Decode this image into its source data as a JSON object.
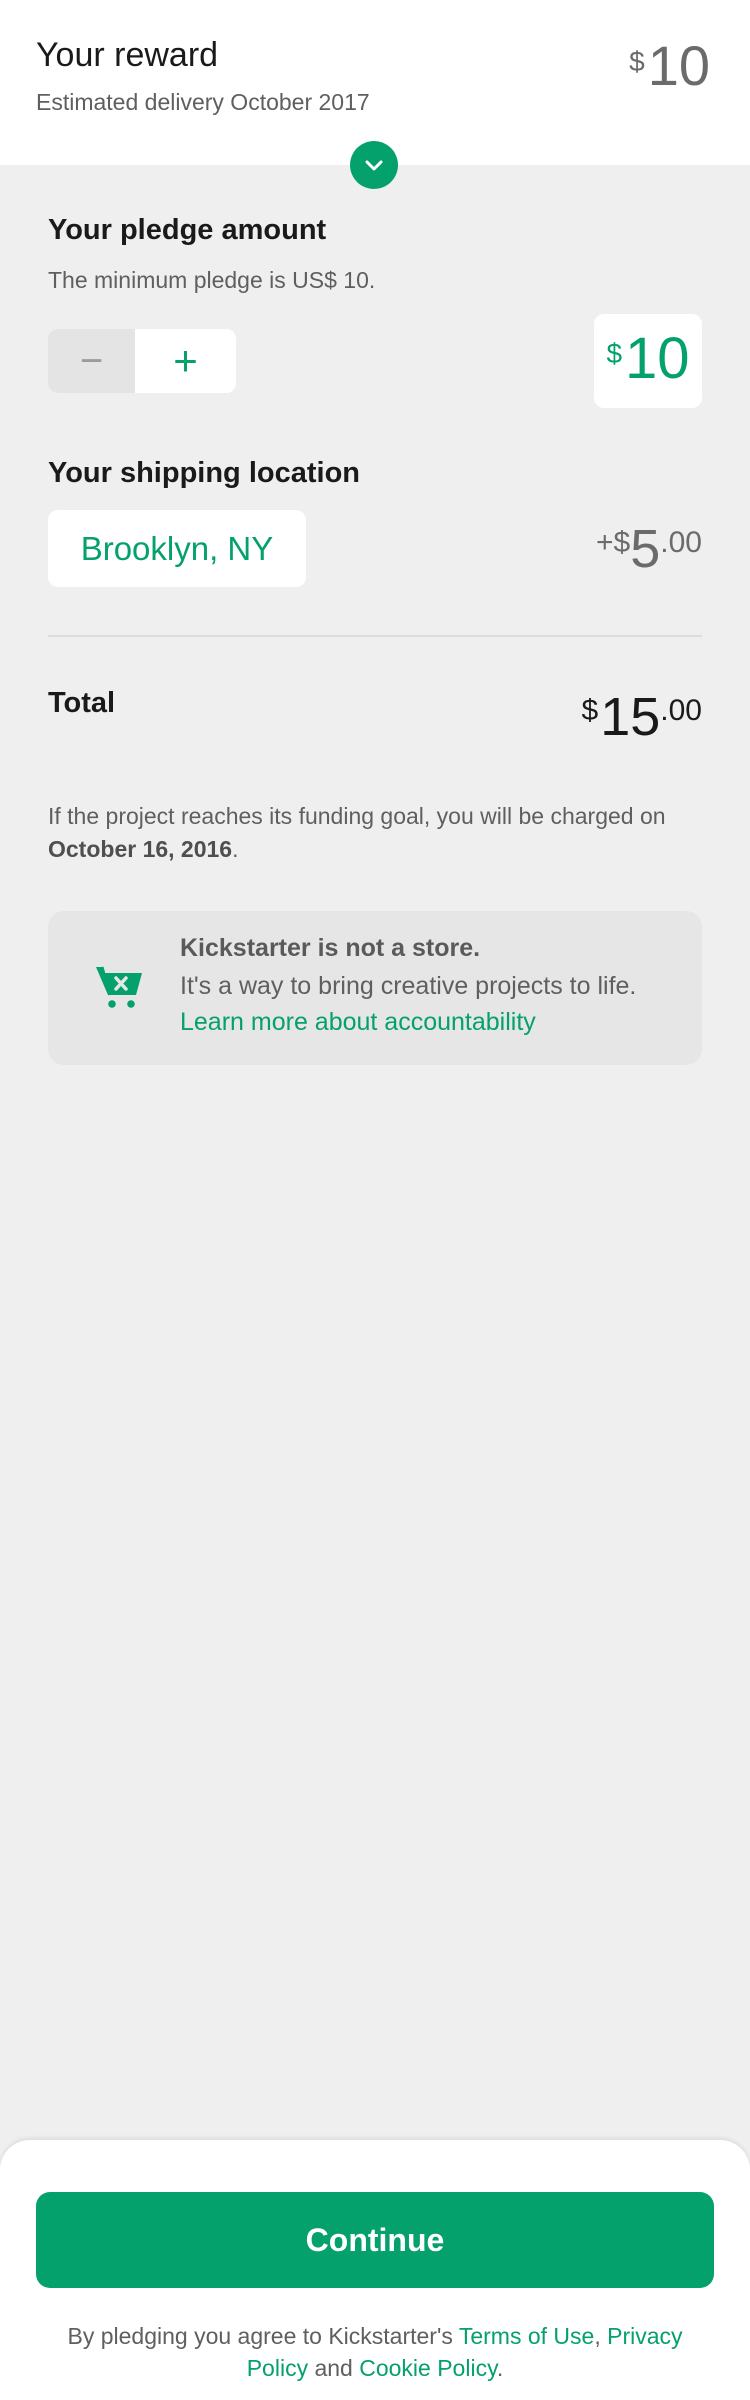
{
  "reward": {
    "title": "Your reward",
    "delivery": "Estimated delivery October 2017",
    "currency": "$",
    "amount": "10"
  },
  "pledge": {
    "title": "Your pledge amount",
    "minimum_note": "The minimum pledge is US$ 10.",
    "minus_label": "−",
    "plus_label": "+",
    "currency": "$",
    "amount": "10"
  },
  "shipping": {
    "title": "Your shipping location",
    "location": "Brooklyn, NY",
    "cost_prefix": "+$",
    "cost_whole": "5",
    "cost_decimal": ".00"
  },
  "total": {
    "label": "Total",
    "currency": "$",
    "whole": "15",
    "decimal": ".00"
  },
  "charge_note": {
    "text": "If the project reaches its funding goal, you will be charged on ",
    "date": "October 16, 2016",
    "end": "."
  },
  "info_card": {
    "title": "Kickstarter is not a store.",
    "text": "It's a way to bring creative projects to life. ",
    "link": "Learn more about accountability",
    "icon": "cart-x-icon"
  },
  "footer": {
    "continue_label": "Continue",
    "legal_prefix": "By pledging you agree to Kickstarter's ",
    "terms_link": "Terms of Use",
    "sep1": ", ",
    "privacy_link": "Privacy Policy",
    "sep2": " and ",
    "cookie_link": "Cookie Policy",
    "end": "."
  },
  "colors": {
    "accent": "#05a16c",
    "background": "#efefef",
    "card": "#ffffff"
  }
}
